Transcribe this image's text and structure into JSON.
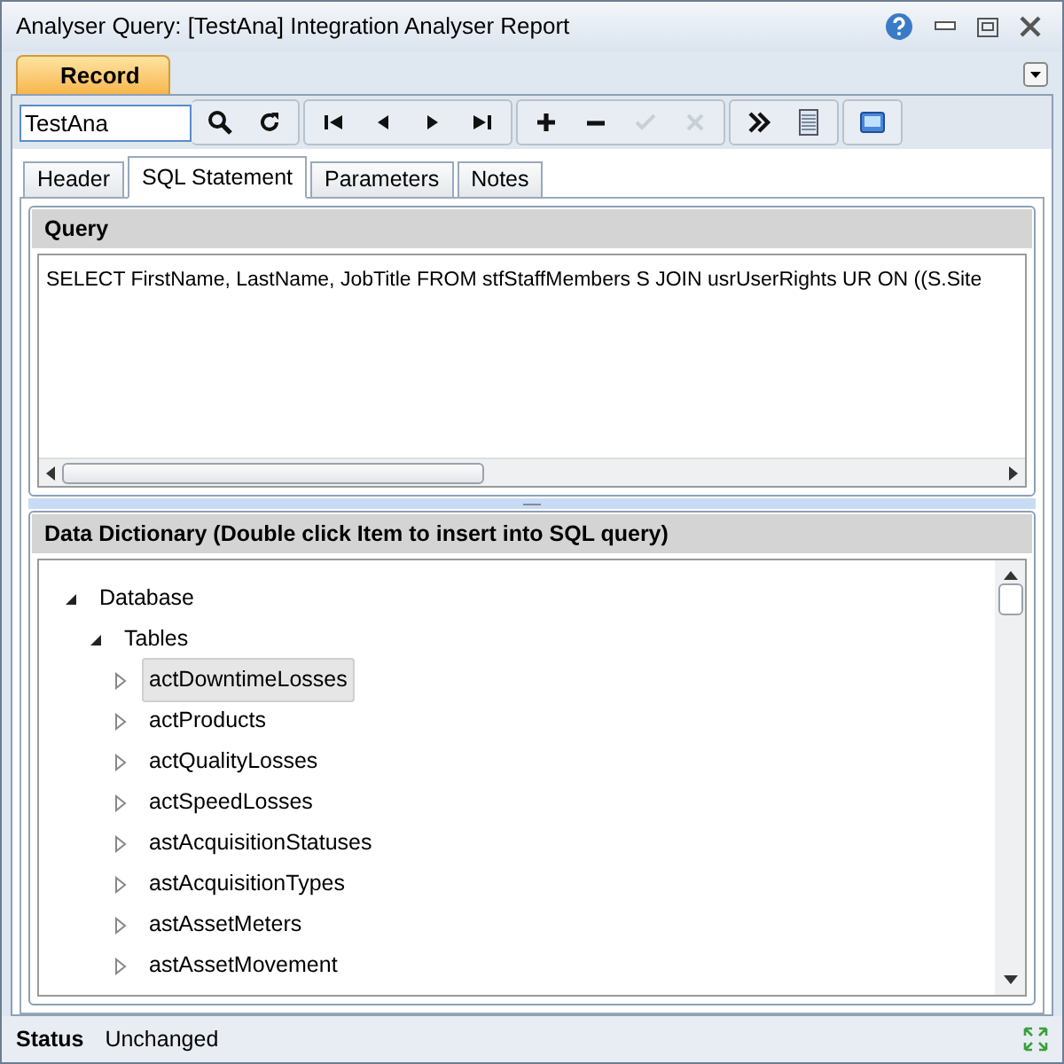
{
  "window": {
    "title": "Analyser Query: [TestAna] Integration Analyser Report"
  },
  "ribbon_tabs": [
    {
      "label": "Record",
      "selected": true
    }
  ],
  "toolbar": {
    "search_value": "TestAna",
    "groups": [
      [
        {
          "kind": "search",
          "disabled": false
        },
        {
          "kind": "refresh",
          "disabled": false
        }
      ],
      [
        {
          "kind": "first",
          "disabled": false
        },
        {
          "kind": "prev",
          "disabled": false
        },
        {
          "kind": "next",
          "disabled": false
        },
        {
          "kind": "last",
          "disabled": false
        }
      ],
      [
        {
          "kind": "add",
          "disabled": false
        },
        {
          "kind": "remove",
          "disabled": false
        },
        {
          "kind": "save",
          "disabled": true
        },
        {
          "kind": "cancel",
          "disabled": true
        }
      ],
      [
        {
          "kind": "more",
          "disabled": false
        },
        {
          "kind": "list",
          "disabled": false
        }
      ],
      [
        {
          "kind": "screen",
          "disabled": false
        }
      ]
    ]
  },
  "tabs": [
    {
      "label": "Header",
      "selected": false
    },
    {
      "label": "SQL Statement",
      "selected": true
    },
    {
      "label": "Parameters",
      "selected": false
    },
    {
      "label": "Notes",
      "selected": false
    }
  ],
  "query": {
    "title": "Query",
    "text": "SELECT FirstName, LastName, JobTitle FROM stfStaffMembers S JOIN usrUserRights UR ON ((S.Site"
  },
  "dictionary": {
    "title": "Data Dictionary (Double click Item to insert into SQL query)",
    "tree": [
      {
        "label": "Database",
        "expanded": true,
        "selected": false,
        "children": [
          {
            "label": "Tables",
            "expanded": true,
            "selected": false,
            "children": [
              {
                "label": "actDowntimeLosses",
                "expanded": false,
                "selected": true
              },
              {
                "label": "actProducts",
                "expanded": false,
                "selected": false
              },
              {
                "label": "actQualityLosses",
                "expanded": false,
                "selected": false
              },
              {
                "label": "actSpeedLosses",
                "expanded": false,
                "selected": false
              },
              {
                "label": "astAcquisitionStatuses",
                "expanded": false,
                "selected": false
              },
              {
                "label": "astAcquisitionTypes",
                "expanded": false,
                "selected": false
              },
              {
                "label": "astAssetMeters",
                "expanded": false,
                "selected": false
              },
              {
                "label": "astAssetMovement",
                "expanded": false,
                "selected": false
              }
            ]
          }
        ]
      }
    ]
  },
  "status_bar": {
    "label": "Status",
    "value": "Unchanged"
  }
}
